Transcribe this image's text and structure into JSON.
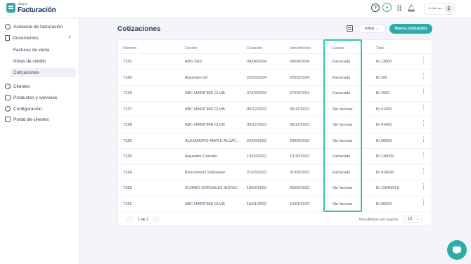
{
  "app": {
    "brand_small": "alegra",
    "brand": "Facturación",
    "company_name": "La Halle pzo",
    "avatar_initial": "E",
    "accent": "#30aba9",
    "highlight": "#2ec4a6"
  },
  "topbar": {
    "icons": [
      "help-icon",
      "chat-icon",
      "apps-grid-icon",
      "bell-icon"
    ]
  },
  "sidebar": {
    "assistant": "Asistente de facturación",
    "documents": "Documentos",
    "sub_items": [
      "Facturas de venta",
      "Notas de crédito",
      "Cotizaciones"
    ],
    "active_sub": "Cotizaciones",
    "items": [
      "Clientes",
      "Productos y servicios",
      "Configuración",
      "Portal de clientes"
    ]
  },
  "main": {
    "title": "Cotizaciones",
    "filter_label": "Filtrar",
    "new_label": "Nueva cotización",
    "columns": [
      "Número",
      "Cliente",
      "Creación",
      "Vencimiento",
      "Estado",
      "Total"
    ],
    "rows": [
      {
        "numero": "7131",
        "cliente": "ABS SAS",
        "creacion": "09/04/2024",
        "vencimiento": "09/04/2024",
        "estado": "Facturada",
        "total": "B/.13800"
      },
      {
        "numero": "7130",
        "cliente": "Alejandro Gil",
        "creacion": "22/03/2024",
        "vencimiento": "22/03/2024",
        "estado": "Facturada",
        "total": "B/.165"
      },
      {
        "numero": "7129",
        "cliente": "ABC MARITIME CLUB",
        "creacion": "07/03/2024",
        "vencimiento": "07/03/2024",
        "estado": "Facturada",
        "total": "B/.1500"
      },
      {
        "numero": "7127",
        "cliente": "ABC MARITIME CLUB",
        "creacion": "05/12/2023",
        "vencimiento": "05/12/2023",
        "estado": "Sin facturar",
        "total": "B/.41400"
      },
      {
        "numero": "7128",
        "cliente": "ABC MARITIME CLUB",
        "creacion": "05/12/2023",
        "vencimiento": "05/12/2023",
        "estado": "Sin facturar",
        "total": "B/.41400"
      },
      {
        "numero": "7126",
        "cliente": "ALEJANDRO AMPLE ALCAY...",
        "creacion": "20/03/2023",
        "vencimiento": "20/03/2023",
        "estado": "Sin facturar",
        "total": "B/.96600"
      },
      {
        "numero": "7125",
        "cliente": "Alejandro Castaño",
        "creacion": "13/09/2022",
        "vencimiento": "13/10/2022",
        "estado": "Facturada",
        "total": "B/.138000"
      },
      {
        "numero": "7124",
        "cliente": "Broccoincini Sorpresas",
        "creacion": "21/03/2022",
        "vencimiento": "21/03/2022",
        "estado": "Facturada",
        "total": "B/.414000"
      },
      {
        "numero": "7123",
        "cliente": "ALVARO GONZALEZ SISTAC",
        "creacion": "18/02/2022",
        "vencimiento": "25/02/2022",
        "estado": "Sin facturar",
        "total": "B/.1104004,5"
      },
      {
        "numero": "7121",
        "cliente": "ABC MARITIME CLUB",
        "creacion": "15/01/2022",
        "vencimiento": "15/01/2022",
        "estado": "Sin facturar",
        "total": "B/.96600"
      }
    ],
    "pagination": {
      "label": "1 de 2",
      "rpp_label": "Resultados por página",
      "rpp_value": "10"
    }
  }
}
